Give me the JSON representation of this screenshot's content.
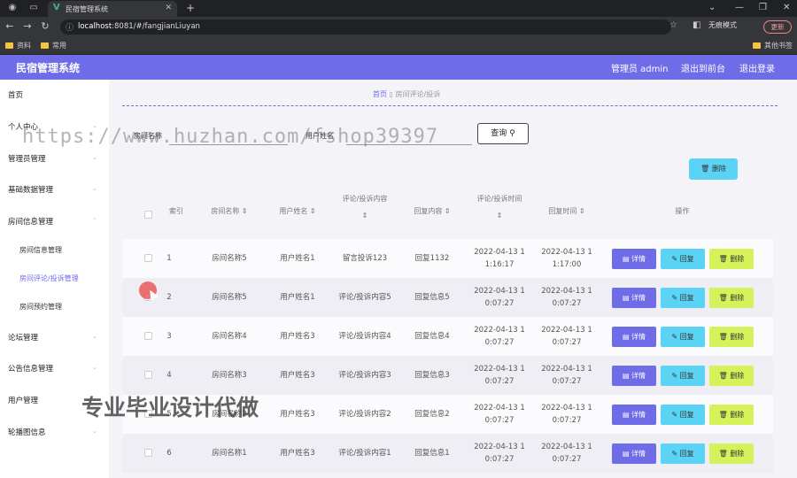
{
  "browser": {
    "tab_title": "民宿管理系统",
    "url_host": "localhost",
    "url_rest": ":8081/#/fangjianLiuyan",
    "incognito_label": "无痕模式",
    "update_label": "更新",
    "bookmarks": [
      "资料",
      "常用"
    ],
    "other_bookmarks": "其他书签"
  },
  "header": {
    "app_title": "民宿管理系统",
    "user_label": "管理员 admin",
    "back_label": "退出到前台",
    "logout_label": "退出登录",
    "accent_color": "#6f6ce8"
  },
  "sidebar": {
    "items": [
      {
        "label": "首页"
      },
      {
        "label": "个人中心"
      },
      {
        "label": "管理员管理"
      },
      {
        "label": "基础数据管理"
      },
      {
        "label": "房间信息管理"
      },
      {
        "label": "房间信息管理"
      },
      {
        "label": "房间评论/投诉管理"
      },
      {
        "label": "房间预约管理"
      },
      {
        "label": "论坛管理"
      },
      {
        "label": "公告信息管理"
      },
      {
        "label": "用户管理"
      },
      {
        "label": "轮播图信息"
      }
    ]
  },
  "breadcrumb": {
    "home": "首页",
    "current": "房间评论/投诉"
  },
  "search": {
    "room_label": "房间名称",
    "user_label": "用户姓名",
    "query_label": "查询"
  },
  "toolbar": {
    "delete_label": "删除"
  },
  "table": {
    "headers": [
      "索引",
      "房间名称",
      "用户姓名",
      "评论/投诉内容",
      "回复内容",
      "评论/投诉时间",
      "回复时间",
      "操作"
    ],
    "rows": [
      {
        "index": "1",
        "room": "房间名称5",
        "user": "用户姓名1",
        "content": "留言投诉123",
        "reply": "回复1132",
        "time1a": "2022-04-13 1",
        "time1b": "1:16:17",
        "time2a": "2022-04-13 1",
        "time2b": "1:17:00"
      },
      {
        "index": "2",
        "room": "房间名称5",
        "user": "用户姓名1",
        "content": "评论/投诉内容5",
        "reply": "回复信息5",
        "time1a": "2022-04-13 1",
        "time1b": "0:07:27",
        "time2a": "2022-04-13 1",
        "time2b": "0:07:27"
      },
      {
        "index": "3",
        "room": "房间名称4",
        "user": "用户姓名3",
        "content": "评论/投诉内容4",
        "reply": "回复信息4",
        "time1a": "2022-04-13 1",
        "time1b": "0:07:27",
        "time2a": "2022-04-13 1",
        "time2b": "0:07:27"
      },
      {
        "index": "4",
        "room": "房间名称3",
        "user": "用户姓名3",
        "content": "评论/投诉内容3",
        "reply": "回复信息3",
        "time1a": "2022-04-13 1",
        "time1b": "0:07:27",
        "time2a": "2022-04-13 1",
        "time2b": "0:07:27"
      },
      {
        "index": "5",
        "room": "房间名称2",
        "user": "用户姓名3",
        "content": "评论/投诉内容2",
        "reply": "回复信息2",
        "time1a": "2022-04-13 1",
        "time1b": "0:07:27",
        "time2a": "2022-04-13 1",
        "time2b": "0:07:27"
      },
      {
        "index": "6",
        "room": "房间名称1",
        "user": "用户姓名3",
        "content": "评论/投诉内容1",
        "reply": "回复信息1",
        "time1a": "2022-04-13 1",
        "time1b": "0:07:27",
        "time2a": "2022-04-13 1",
        "time2b": "0:07:27"
      }
    ],
    "action_detail": "详情",
    "action_reply": "回复",
    "action_delete": "删除"
  },
  "overlay": {
    "watermark": "https://www.huzhan.com/fshop39397",
    "promo": "专业毕业设计代做"
  }
}
